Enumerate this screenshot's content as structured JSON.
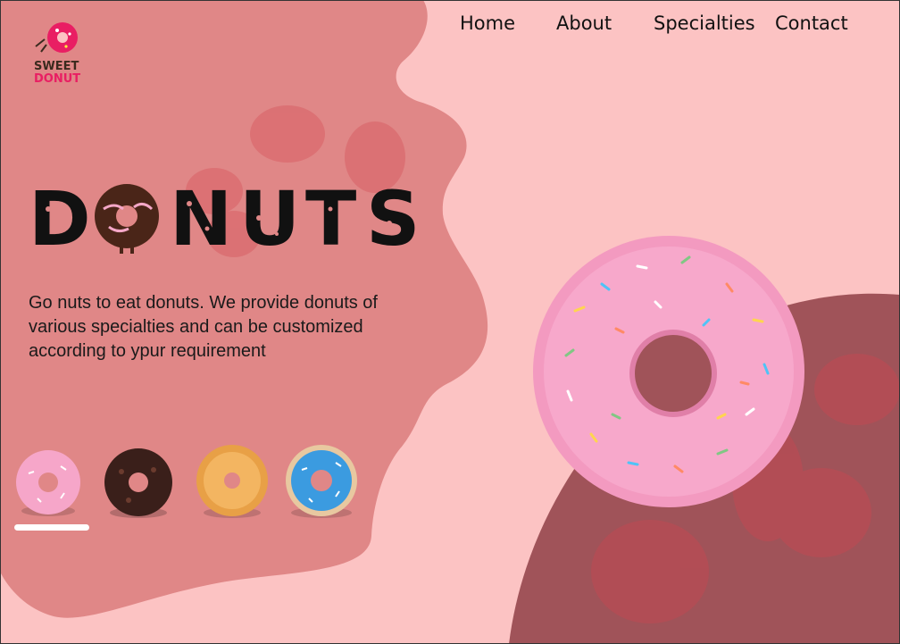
{
  "brand": {
    "line1": "SWEET",
    "line2": "DONUT"
  },
  "nav": {
    "items": [
      "Home",
      "About",
      "Specialties",
      "Contact"
    ]
  },
  "hero": {
    "title_letters": [
      "D",
      "N",
      "U",
      "T",
      "S"
    ],
    "tagline": "Go nuts to eat donuts. We provide donuts of various specialties and can be customized according to ypur requirement"
  },
  "thumbnails": [
    {
      "name": "pink-sprinkle-donut",
      "color": "#f6a6c9"
    },
    {
      "name": "chocolate-donut",
      "color": "#3a1f1a"
    },
    {
      "name": "glazed-donut",
      "color": "#e8a046"
    },
    {
      "name": "blue-sprinkle-donut",
      "color": "#3b9be0"
    }
  ],
  "selected_thumbnail": 1,
  "colors": {
    "background": "#fcc3c3",
    "blob": "#e08787",
    "dark_circle": "#a05359",
    "brand_pink": "#e91e63"
  }
}
